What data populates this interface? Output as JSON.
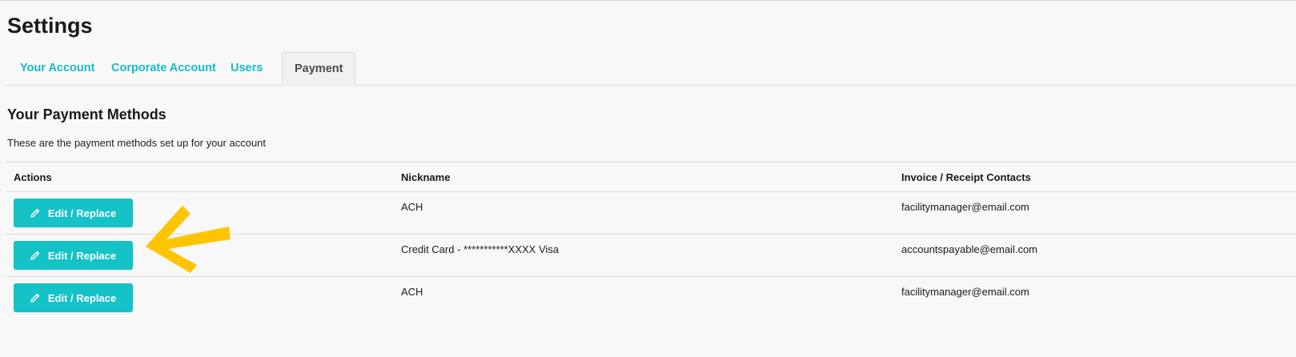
{
  "page": {
    "title": "Settings"
  },
  "tabs": [
    {
      "label": "Your Account",
      "active": false
    },
    {
      "label": "Corporate Account",
      "active": false
    },
    {
      "label": "Users",
      "active": false
    },
    {
      "label": "Payment",
      "active": true
    }
  ],
  "payment": {
    "section_title": "Your Payment Methods",
    "description": "These are the payment methods set up for your account",
    "columns": {
      "actions": "Actions",
      "nickname": "Nickname",
      "contacts": "Invoice / Receipt Contacts"
    },
    "rows": [
      {
        "action_label": "Edit / Replace",
        "nickname": "ACH",
        "contact": "facilitymanager@email.com"
      },
      {
        "action_label": "Edit / Replace",
        "nickname": "Credit Card - ***********XXXX Visa",
        "contact": "accountspayable@email.com"
      },
      {
        "action_label": "Edit / Replace",
        "nickname": "ACH",
        "contact": "facilitymanager@email.com"
      }
    ]
  },
  "icons": {
    "edit": "pencil-icon",
    "annotation": "arrow-left-icon"
  },
  "colors": {
    "accent": "#14c2c8",
    "tab_link": "#16bcc4",
    "annotation_arrow": "#ffc400"
  }
}
